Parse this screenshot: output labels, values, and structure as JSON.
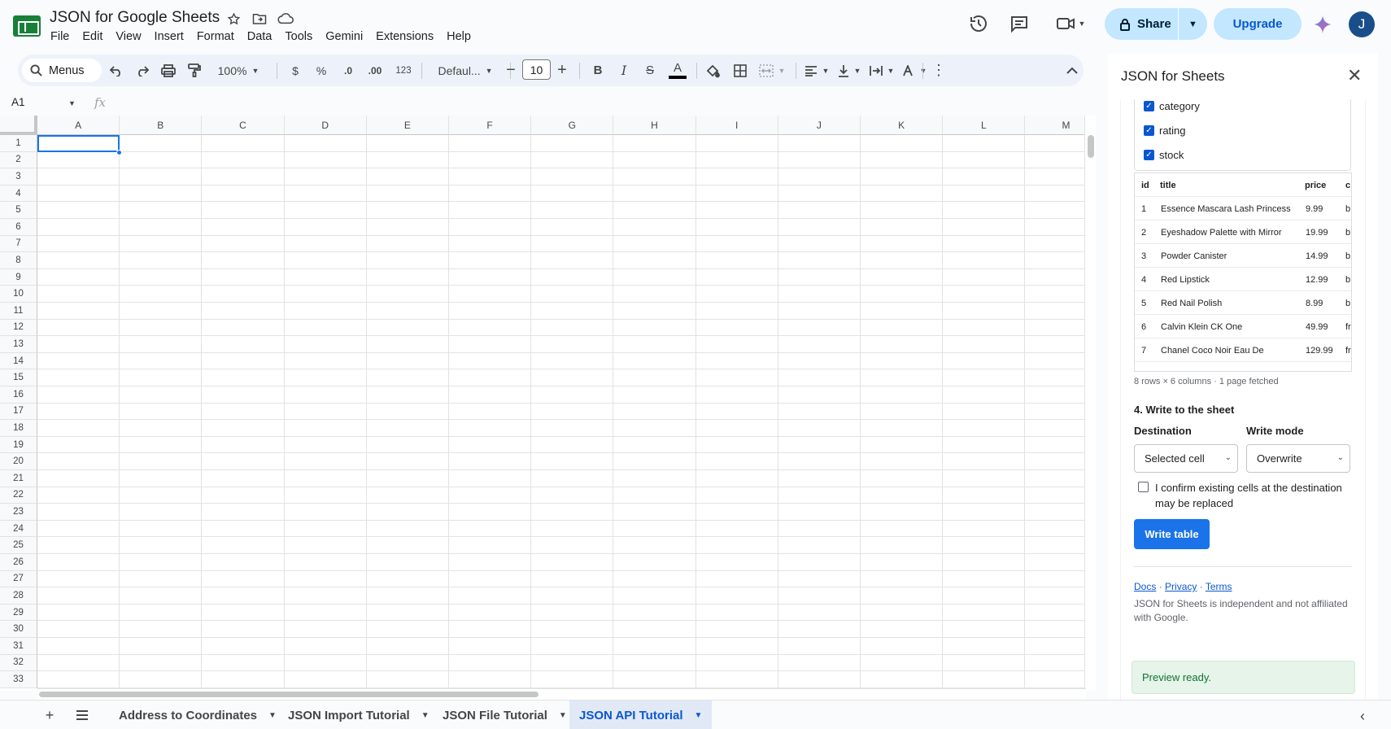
{
  "app": {
    "title": "JSON for Google Sheets",
    "menu": [
      "File",
      "Edit",
      "View",
      "Insert",
      "Format",
      "Data",
      "Tools",
      "Gemini",
      "Extensions",
      "Help"
    ],
    "share_label": "Share",
    "upgrade_label": "Upgrade",
    "avatar_initial": "J"
  },
  "toolbar": {
    "menus_label": "Menus",
    "zoom": "100%",
    "currency": "$",
    "percent": "%",
    "dec_decrease": ".0",
    "dec_increase": ".00",
    "number_format": "123",
    "font": "Defaul...",
    "font_size": "10",
    "bold": "B",
    "italic": "I",
    "strike": "S",
    "text_color_letter": "A"
  },
  "formula": {
    "cell_ref": "A1",
    "fx": "fx"
  },
  "grid": {
    "columns": [
      "A",
      "B",
      "C",
      "D",
      "E",
      "F",
      "G",
      "H",
      "I",
      "J",
      "K",
      "L",
      "M"
    ],
    "rows": [
      "1",
      "2",
      "3",
      "4",
      "5",
      "6",
      "7",
      "8",
      "9",
      "10",
      "11",
      "12",
      "13",
      "14",
      "15",
      "16",
      "17",
      "18",
      "19",
      "20",
      "21",
      "22",
      "23",
      "24",
      "25",
      "26",
      "27",
      "28",
      "29",
      "30",
      "31",
      "32",
      "33"
    ]
  },
  "sheets": {
    "tabs": [
      {
        "label": "Address to Coordinates",
        "active": false
      },
      {
        "label": "JSON Import Tutorial",
        "active": false
      },
      {
        "label": "JSON File Tutorial",
        "active": false
      },
      {
        "label": "JSON API Tutorial",
        "active": true
      }
    ]
  },
  "panel": {
    "title": "JSON for Sheets",
    "fields": [
      {
        "label": "category",
        "checked": true
      },
      {
        "label": "rating",
        "checked": true
      },
      {
        "label": "stock",
        "checked": true
      }
    ],
    "preview": {
      "headers": [
        "id",
        "title",
        "price",
        "c"
      ],
      "rows": [
        [
          "1",
          "Essence Mascara Lash Princess",
          "9.99",
          "b"
        ],
        [
          "2",
          "Eyeshadow Palette with Mirror",
          "19.99",
          "b"
        ],
        [
          "3",
          "Powder Canister",
          "14.99",
          "b"
        ],
        [
          "4",
          "Red Lipstick",
          "12.99",
          "b"
        ],
        [
          "5",
          "Red Nail Polish",
          "8.99",
          "b"
        ],
        [
          "6",
          "Calvin Klein CK One",
          "49.99",
          "fr"
        ],
        [
          "7",
          "Chanel Coco Noir Eau De",
          "129.99",
          "fr"
        ]
      ],
      "meta": "8 rows × 6 columns · 1 page fetched"
    },
    "write_section_title": "4. Write to the sheet",
    "destination_label": "Destination",
    "destination_value": "Selected cell",
    "write_mode_label": "Write mode",
    "write_mode_value": "Overwrite",
    "confirm_text": "I confirm existing cells at the destination may be replaced",
    "write_button": "Write table",
    "links": [
      "Docs",
      "Privacy",
      "Terms"
    ],
    "link_sep": "·",
    "disclaimer": "JSON for Sheets is independent and not affiliated with Google.",
    "toast": "Preview ready."
  },
  "colors": {
    "accent": "#1a73e8",
    "share_bg": "#c2e7ff",
    "active_tab_bg": "#e1e9f7",
    "toast_bg": "#e6f4ea"
  }
}
